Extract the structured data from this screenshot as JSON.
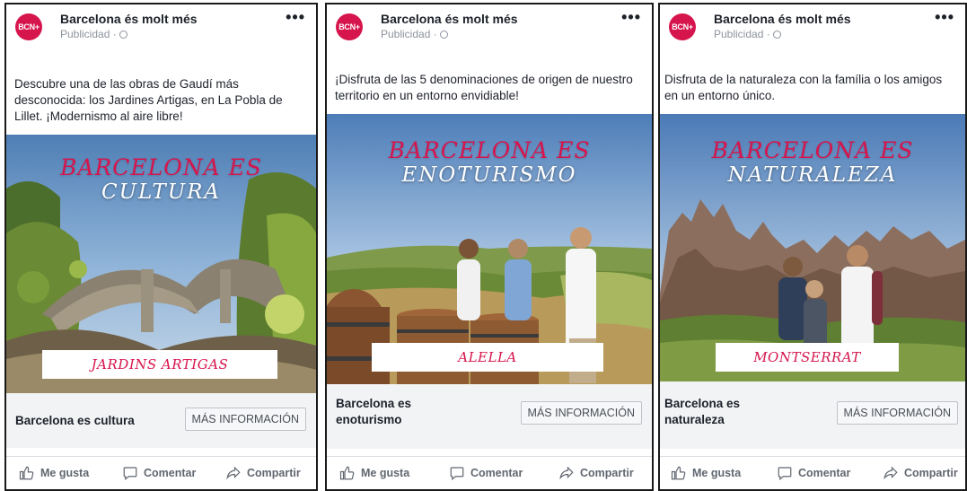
{
  "brand": {
    "page_name": "Barcelona és molt més",
    "sponsored": "Publicidad ·",
    "logo_text": "BCN+",
    "accent": "#d6154d"
  },
  "cards": [
    {
      "caption": "Descubre una de las obras de Gaudí más desconocida: los Jardines Artigas, en La Pobla de Lillet. ¡Modernismo al aire libre!",
      "banner_line1": "BARCELONA ES",
      "banner_line2": "CULTURA",
      "place": "JARDINS ARTIGAS",
      "footer_title": "Barcelona es cultura",
      "cta": "MÁS INFORMACIÓN"
    },
    {
      "caption": "¡Disfruta de las 5 denominaciones de origen de nuestro territorio en un entorno envidiable!",
      "banner_line1": "BARCELONA ES",
      "banner_line2": "ENOTURISMO",
      "place": "ALELLA",
      "footer_title": "Barcelona es enoturismo",
      "cta": "MÁS INFORMACIÓN"
    },
    {
      "caption": "Disfruta de la naturaleza con la família o los amigos en un entorno único.",
      "banner_line1": "BARCELONA ES",
      "banner_line2": "NATURALEZA",
      "place": "MONTSERRAT",
      "footer_title": "Barcelona es naturaleza",
      "cta": "MÁS INFORMACIÓN"
    }
  ],
  "actions": {
    "like": "Me gusta",
    "comment": "Comentar",
    "share": "Compartir"
  },
  "icons": {
    "like": "thumbs-up-icon",
    "comment": "comment-bubble-icon",
    "share": "share-arrow-icon",
    "more": "more-dots-icon",
    "globe": "globe-icon"
  }
}
